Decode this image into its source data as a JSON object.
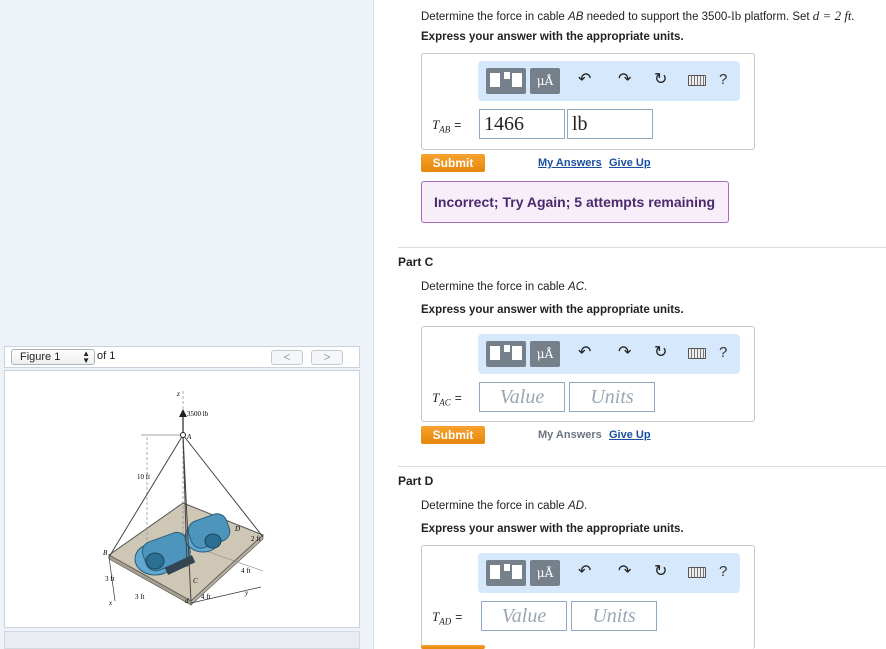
{
  "figure": {
    "selector_label": "Figure 1",
    "of_label": "of 1",
    "prev_label": "<",
    "next_label": ">",
    "labels": {
      "load": "3500 lb",
      "z": "z",
      "a": "A",
      "b": "B",
      "c": "C",
      "d_point": "D",
      "height": "10 ft",
      "two_ft": "2 ft",
      "three_ft_a": "3 ft",
      "three_ft_b": "3 ft",
      "four_ft_a": "4 ft",
      "four_ft_b": "4 ft",
      "d_dim": "d",
      "x": "x",
      "y": "y"
    }
  },
  "part_b": {
    "question_prefix": "Determine the force in cable ",
    "question_var": "AB",
    "question_mid": " needed to support the 3500-",
    "question_unit": "lb",
    "question_suffix": " platform. Set ",
    "question_set": "d = 2 ft.",
    "instruction": "Express your answer with the appropriate units.",
    "var_main": "T",
    "var_sub": "AB",
    "eq": "=",
    "value": "1466",
    "units": "lb",
    "submit": "Submit",
    "my_answers": "My Answers",
    "give_up": "Give Up",
    "feedback": "Incorrect; Try Again; 5 attempts remaining"
  },
  "part_c": {
    "title": "Part C",
    "question_prefix": "Determine the force in cable ",
    "question_var": "AC",
    "question_suffix": ".",
    "instruction": "Express your answer with the appropriate units.",
    "var_main": "T",
    "var_sub": "AC",
    "eq": "=",
    "value_placeholder": "Value",
    "units_placeholder": "Units",
    "submit": "Submit",
    "my_answers": "My Answers",
    "give_up": "Give Up"
  },
  "part_d": {
    "title": "Part D",
    "question_prefix": "Determine the force in cable ",
    "question_var": "AD",
    "question_suffix": ".",
    "instruction": "Express your answer with the appropriate units.",
    "var_main": "T",
    "var_sub": "AD",
    "eq": "=",
    "value_placeholder": "Value",
    "units_placeholder": "Units"
  },
  "toolbar": {
    "mu_label": "μÅ",
    "help_label": "?",
    "icons": [
      "templates-icon",
      "units-icon",
      "undo-icon",
      "redo-icon",
      "reset-icon",
      "keyboard-icon",
      "help-icon"
    ]
  },
  "colors": {
    "accent_orange": "#f08c1a",
    "link_blue": "#1a4fa0",
    "toolbar_bg": "#d6e8fb",
    "incorrect_border": "#a86bc0"
  }
}
